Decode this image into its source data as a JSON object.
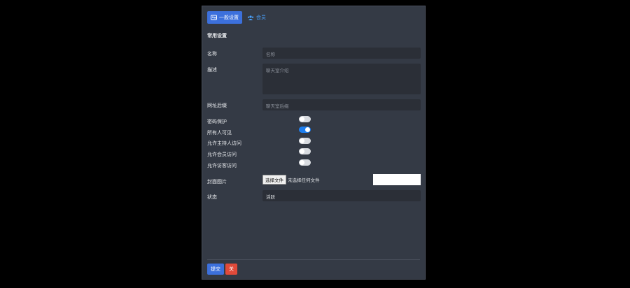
{
  "tabs": [
    {
      "label": "一般设置",
      "icon": "id-card-icon",
      "active": true
    },
    {
      "label": "会员",
      "icon": "users-icon",
      "active": false
    }
  ],
  "section_title": "常用设置",
  "fields": {
    "name": {
      "label": "名称",
      "placeholder": "名称"
    },
    "description": {
      "label": "描述",
      "placeholder": "聊天室介绍"
    },
    "url_suffix": {
      "label": "网址后缀",
      "placeholder": "聊天室后缀"
    }
  },
  "toggles": [
    {
      "label": "密码保护",
      "on": false
    },
    {
      "label": "所有人可见",
      "on": true
    },
    {
      "label": "允许主持人访问",
      "on": false
    },
    {
      "label": "允许会员访问",
      "on": false
    },
    {
      "label": "允许访客访问",
      "on": false
    }
  ],
  "cover": {
    "label": "封面图片",
    "button": "选择文件",
    "status": "未选择任何文件"
  },
  "status": {
    "label": "状态",
    "value": "活跃"
  },
  "actions": {
    "submit": "提交",
    "close": "关"
  },
  "colors": {
    "primary": "#3c70dc",
    "danger": "#e04a3a",
    "toggle_on": "#1e7ff0",
    "panel": "#343a45",
    "input": "#2b2f37"
  }
}
